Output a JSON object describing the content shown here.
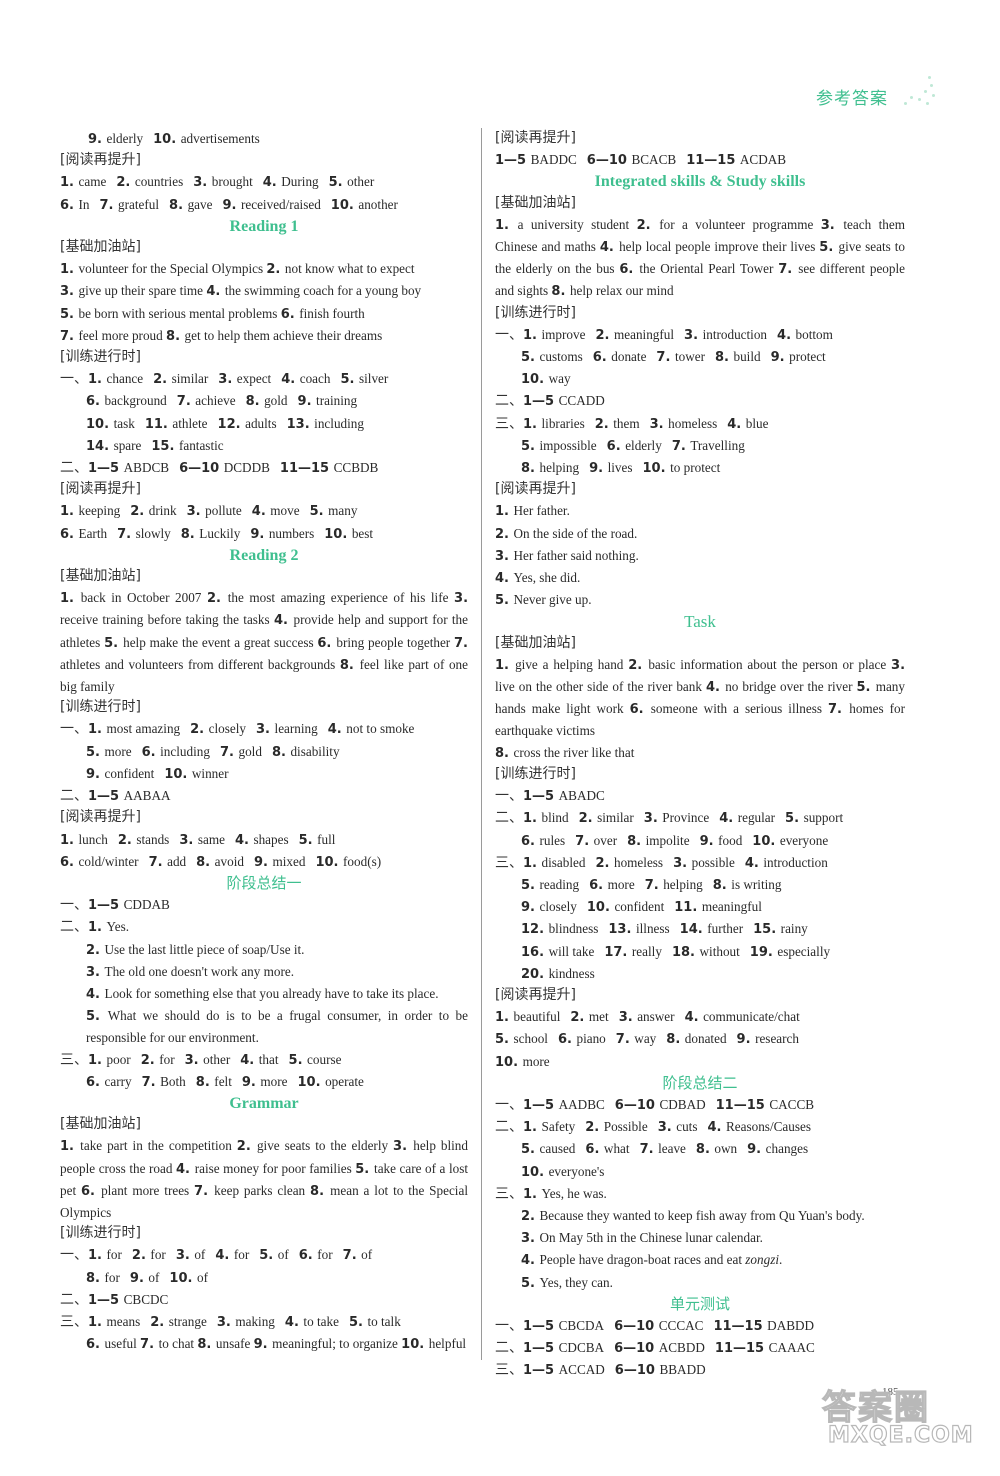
{
  "header": {
    "label": "参考答案"
  },
  "left": {
    "l1": [
      [
        "9",
        "elderly"
      ],
      [
        "10",
        "advertisements"
      ]
    ],
    "tag_reading1": "[阅读再提升]",
    "l2": [
      [
        "1",
        "came"
      ],
      [
        "2",
        "countries"
      ],
      [
        "3",
        "brought"
      ],
      [
        "4",
        "During"
      ],
      [
        "5",
        "other"
      ]
    ],
    "l3": [
      [
        "6",
        "In"
      ],
      [
        "7",
        "grateful"
      ],
      [
        "8",
        "gave"
      ],
      [
        "9",
        "received/raised"
      ],
      [
        "10",
        "another"
      ]
    ],
    "reading1": {
      "title": "Reading 1",
      "tag_basic": "[基础加油站]",
      "basic": [
        "1. volunteer for the Special Olympics   2. not know what to expect",
        "3. give up their spare time   4. the swimming coach for a young boy",
        "5. be born with serious mental problems   6. finish fourth",
        "7. feel more proud   8. get to help them achieve their dreams"
      ],
      "tag_practice": "[训练进行时]",
      "p1_prefix": "一、",
      "p1_rows": [
        [
          [
            "1",
            "chance"
          ],
          [
            "2",
            "similar"
          ],
          [
            "3",
            "expect"
          ],
          [
            "4",
            "coach"
          ],
          [
            "5",
            "silver"
          ]
        ],
        [
          [
            "6",
            "background"
          ],
          [
            "7",
            "achieve"
          ],
          [
            "8",
            "gold"
          ],
          [
            "9",
            "training"
          ]
        ],
        [
          [
            "10",
            "task"
          ],
          [
            "11",
            "athlete"
          ],
          [
            "12",
            "adults"
          ],
          [
            "13",
            "including"
          ]
        ],
        [
          [
            "14",
            "spare"
          ],
          [
            "15",
            "fantastic"
          ]
        ]
      ],
      "p2_prefix": "二、",
      "p2": [
        [
          "1—5",
          "ABDCB"
        ],
        [
          "6—10",
          "DCDDB"
        ],
        [
          "11—15",
          "CCBDB"
        ]
      ],
      "tag_reading": "[阅读再提升]",
      "r_rows": [
        [
          [
            "1",
            "keeping"
          ],
          [
            "2",
            "drink"
          ],
          [
            "3",
            "pollute"
          ],
          [
            "4",
            "move"
          ],
          [
            "5",
            "many"
          ]
        ],
        [
          [
            "6",
            "Earth"
          ],
          [
            "7",
            "slowly"
          ],
          [
            "8",
            "Luckily"
          ],
          [
            "9",
            "numbers"
          ],
          [
            "10",
            "best"
          ]
        ]
      ]
    },
    "reading2": {
      "title": "Reading 2",
      "tag_basic": "[基础加油站]",
      "basic": "1. back in October 2007   2. the most amazing experience of his life   3. receive training before taking the tasks   4. provide help and support for the athletes   5. help make the event a great success   6. bring people together   7. athletes and volunteers from different backgrounds   8. feel like part of one big family",
      "tag_practice": "[训练进行时]",
      "p1_prefix": "一、",
      "p1_rows": [
        [
          [
            "1",
            "most amazing"
          ],
          [
            "2",
            "closely"
          ],
          [
            "3",
            "learning"
          ],
          [
            "4",
            "not to smoke"
          ]
        ],
        [
          [
            "5",
            "more"
          ],
          [
            "6",
            "including"
          ],
          [
            "7",
            "gold"
          ],
          [
            "8",
            "disability"
          ]
        ],
        [
          [
            "9",
            "confident"
          ],
          [
            "10",
            "winner"
          ]
        ]
      ],
      "p2_prefix": "二、",
      "p2": [
        [
          "1—5",
          "AABAA"
        ]
      ],
      "tag_reading": "[阅读再提升]",
      "r_rows": [
        [
          [
            "1",
            "lunch"
          ],
          [
            "2",
            "stands"
          ],
          [
            "3",
            "same"
          ],
          [
            "4",
            "shapes"
          ],
          [
            "5",
            "full"
          ]
        ],
        [
          [
            "6",
            "cold/winter"
          ],
          [
            "7",
            "add"
          ],
          [
            "8",
            "avoid"
          ],
          [
            "9",
            "mixed"
          ],
          [
            "10",
            "food(s)"
          ]
        ]
      ]
    },
    "summary1": {
      "title": "阶段总结一",
      "p1_prefix": "一、",
      "p1": [
        [
          "1—5",
          "CDDAB"
        ]
      ],
      "p2_prefix": "二、",
      "p2": [
        [
          "1",
          "Yes."
        ],
        [
          "2",
          "Use the last little piece of soap/Use it."
        ],
        [
          "3",
          "The old one doesn't work any more."
        ],
        [
          "4",
          "Look for something else that you already have to take its place."
        ],
        [
          "5",
          "What we should do is to be a frugal consumer, in order to be responsible for our environment."
        ]
      ],
      "p3_prefix": "三、",
      "p3_rows": [
        [
          [
            "1",
            "poor"
          ],
          [
            "2",
            "for"
          ],
          [
            "3",
            "other"
          ],
          [
            "4",
            "that"
          ],
          [
            "5",
            "course"
          ]
        ],
        [
          [
            "6",
            "carry"
          ],
          [
            "7",
            "Both"
          ],
          [
            "8",
            "felt"
          ],
          [
            "9",
            "more"
          ],
          [
            "10",
            "operate"
          ]
        ]
      ]
    },
    "grammar": {
      "title": "Grammar",
      "tag_basic": "[基础加油站]",
      "basic": "1. take part in the competition   2. give seats to the elderly   3. help blind people cross the road   4. raise money for poor families   5. take care of a lost pet   6. plant more trees   7. keep parks clean   8. mean a lot to the Special Olympics",
      "tag_practice": "[训练进行时]",
      "p1_prefix": "一、",
      "p1_rows": [
        [
          [
            "1",
            "for"
          ],
          [
            "2",
            "for"
          ],
          [
            "3",
            "of"
          ],
          [
            "4",
            "for"
          ],
          [
            "5",
            "of"
          ],
          [
            "6",
            "for"
          ],
          [
            "7",
            "of"
          ]
        ],
        [
          [
            "8",
            "for"
          ],
          [
            "9",
            "of"
          ],
          [
            "10",
            "of"
          ]
        ]
      ],
      "p2_prefix": "二、",
      "p2": [
        [
          "1—5",
          "CBCDC"
        ]
      ],
      "p3_prefix": "三、",
      "p3_line1": [
        [
          "1",
          "means"
        ],
        [
          "2",
          "strange"
        ],
        [
          "3",
          "making"
        ],
        [
          "4",
          "to take"
        ],
        [
          "5",
          "to talk"
        ]
      ],
      "p3_rest": "6. useful   7. to chat   8. unsafe   9. meaningful; to organize   10. helpful"
    }
  },
  "right": {
    "tag_reading": "[阅读再提升]",
    "r0": [
      [
        "1—5",
        "BADDC"
      ],
      [
        "6—10",
        "BCACB"
      ],
      [
        "11—15",
        "ACDAB"
      ]
    ],
    "integrated": {
      "title": "Integrated skills & Study skills",
      "tag_basic": "[基础加油站]",
      "basic": "1. a university student   2. for a volunteer programme   3. teach them Chinese and maths   4. help local people improve their lives   5. give seats to the elderly on the bus   6. the Oriental Pearl Tower   7. see different people and sights   8. help relax our mind",
      "tag_practice": "[训练进行时]",
      "p1_prefix": "一、",
      "p1_rows": [
        [
          [
            "1",
            "improve"
          ],
          [
            "2",
            "meaningful"
          ],
          [
            "3",
            "introduction"
          ],
          [
            "4",
            "bottom"
          ]
        ],
        [
          [
            "5",
            "customs"
          ],
          [
            "6",
            "donate"
          ],
          [
            "7",
            "tower"
          ],
          [
            "8",
            "build"
          ],
          [
            "9",
            "protect"
          ]
        ],
        [
          [
            "10",
            "way"
          ]
        ]
      ],
      "p2_prefix": "二、",
      "p2": [
        [
          "1—5",
          "CCADD"
        ]
      ],
      "p3_prefix": "三、",
      "p3_rows": [
        [
          [
            "1",
            "libraries"
          ],
          [
            "2",
            "them"
          ],
          [
            "3",
            "homeless"
          ],
          [
            "4",
            "blue"
          ]
        ],
        [
          [
            "5",
            "impossible"
          ],
          [
            "6",
            "elderly"
          ],
          [
            "7",
            "Travelling"
          ]
        ],
        [
          [
            "8",
            "helping"
          ],
          [
            "9",
            "lives"
          ],
          [
            "10",
            "to protect"
          ]
        ]
      ],
      "tag_reading": "[阅读再提升]",
      "r_answers": [
        [
          "1",
          "Her father."
        ],
        [
          "2",
          "On the side of the road."
        ],
        [
          "3",
          "Her father said nothing."
        ],
        [
          "4",
          "Yes, she did."
        ],
        [
          "5",
          "Never give up."
        ]
      ]
    },
    "task": {
      "title": "Task",
      "tag_basic": "[基础加油站]",
      "basic": "1. give a helping hand   2. basic information about the person or place   3. live on the other side of the river bank   4. no bridge over the river   5. many hands make light work   6. someone with a serious illness   7. homes for earthquake victims",
      "basic_last": "8. cross the river like that",
      "tag_practice": "[训练进行时]",
      "p1_prefix": "一、",
      "p1": [
        [
          "1—5",
          "ABADC"
        ]
      ],
      "p2_prefix": "二、",
      "p2_rows": [
        [
          [
            "1",
            "blind"
          ],
          [
            "2",
            "similar"
          ],
          [
            "3",
            "Province"
          ],
          [
            "4",
            "regular"
          ],
          [
            "5",
            "support"
          ]
        ],
        [
          [
            "6",
            "rules"
          ],
          [
            "7",
            "over"
          ],
          [
            "8",
            "impolite"
          ],
          [
            "9",
            "food"
          ],
          [
            "10",
            "everyone"
          ]
        ]
      ],
      "p3_prefix": "三、",
      "p3_rows": [
        [
          [
            "1",
            "disabled"
          ],
          [
            "2",
            "homeless"
          ],
          [
            "3",
            "possible"
          ],
          [
            "4",
            "introduction"
          ]
        ],
        [
          [
            "5",
            "reading"
          ],
          [
            "6",
            "more"
          ],
          [
            "7",
            "helping"
          ],
          [
            "8",
            "is writing"
          ]
        ],
        [
          [
            "9",
            "closely"
          ],
          [
            "10",
            "confident"
          ],
          [
            "11",
            "meaningful"
          ]
        ],
        [
          [
            "12",
            "blindness"
          ],
          [
            "13",
            "illness"
          ],
          [
            "14",
            "further"
          ],
          [
            "15",
            "rainy"
          ]
        ],
        [
          [
            "16",
            "will take"
          ],
          [
            "17",
            "really"
          ],
          [
            "18",
            "without"
          ],
          [
            "19",
            "especially"
          ]
        ],
        [
          [
            "20",
            "kindness"
          ]
        ]
      ],
      "tag_reading": "[阅读再提升]",
      "r_rows": [
        [
          [
            "1",
            "beautiful"
          ],
          [
            "2",
            "met"
          ],
          [
            "3",
            "answer"
          ],
          [
            "4",
            "communicate/chat"
          ]
        ],
        [
          [
            "5",
            "school"
          ],
          [
            "6",
            "piano"
          ],
          [
            "7",
            "way"
          ],
          [
            "8",
            "donated"
          ],
          [
            "9",
            "research"
          ]
        ],
        [
          [
            "10",
            "more"
          ]
        ]
      ]
    },
    "summary2": {
      "title": "阶段总结二",
      "p1_prefix": "一、",
      "p1": [
        [
          "1—5",
          "AADBC"
        ],
        [
          "6—10",
          "CDBAD"
        ],
        [
          "11—15",
          "CACCB"
        ]
      ],
      "p2_prefix": "二、",
      "p2_rows": [
        [
          [
            "1",
            "Safety"
          ],
          [
            "2",
            "Possible"
          ],
          [
            "3",
            "cuts"
          ],
          [
            "4",
            "Reasons/Causes"
          ]
        ],
        [
          [
            "5",
            "caused"
          ],
          [
            "6",
            "what"
          ],
          [
            "7",
            "leave"
          ],
          [
            "8",
            "own"
          ],
          [
            "9",
            "changes"
          ]
        ],
        [
          [
            "10",
            "everyone's"
          ]
        ]
      ],
      "p3_prefix": "三、",
      "p3": [
        [
          "1",
          "Yes, he was."
        ],
        [
          "2",
          "Because they wanted to keep fish away from Qu Yuan's body."
        ],
        [
          "3",
          "On May 5th in the Chinese lunar calendar."
        ],
        [
          "4",
          "People have dragon-boat races and eat zongzi."
        ],
        [
          "5",
          "Yes, they can."
        ]
      ]
    },
    "unit_test": {
      "title": "单元测试",
      "rows": [
        {
          "prefix": "一、",
          "groups": [
            [
              "1—5",
              "CBCDA"
            ],
            [
              "6—10",
              "CCCAC"
            ],
            [
              "11—15",
              "DABDD"
            ]
          ]
        },
        {
          "prefix": "二、",
          "groups": [
            [
              "1—5",
              "CDCBA"
            ],
            [
              "6—10",
              "ACBDD"
            ],
            [
              "11—15",
              "CAAAC"
            ]
          ]
        },
        {
          "prefix": "三、",
          "groups": [
            [
              "1—5",
              "ACCAD"
            ],
            [
              "6—10",
              "BBADD"
            ]
          ]
        }
      ]
    }
  },
  "footer": {
    "page_number": "185",
    "watermark_cn": "答案圈",
    "watermark_en": "MXQE.COM"
  }
}
